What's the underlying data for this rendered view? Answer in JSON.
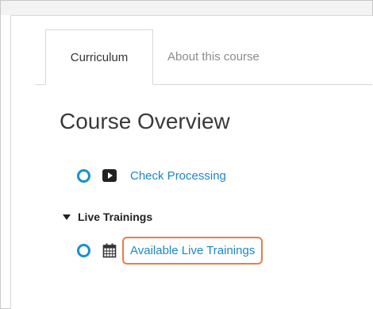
{
  "tabs": [
    {
      "label": "Curriculum",
      "active": true
    },
    {
      "label": "About this course",
      "active": false
    }
  ],
  "overview": {
    "title": "Course Overview"
  },
  "items": {
    "check_processing": {
      "label": "Check Processing",
      "icon": "video-icon",
      "status": "not-started"
    },
    "live_section": {
      "label": "Live Trainings",
      "expanded": true
    },
    "available_live": {
      "label": "Available Live Trainings",
      "icon": "calendar-icon",
      "status": "not-started"
    }
  },
  "colors": {
    "accent": "#1a8ed0",
    "link": "#1d86c8",
    "highlight": "#ee7b45"
  }
}
